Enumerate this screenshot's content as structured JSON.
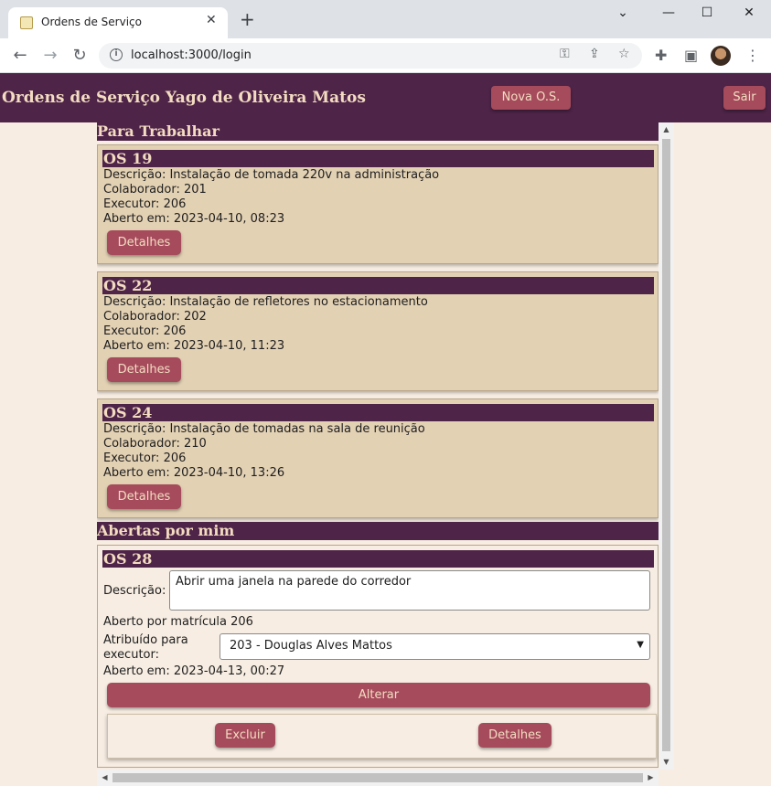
{
  "browser": {
    "tab_title": "Ordens de Serviço",
    "url": "localhost:3000/login"
  },
  "header": {
    "title": "Ordens de Serviço Yago de Oliveira Matos",
    "new_button": "Nova O.S.",
    "logout_button": "Sair"
  },
  "sections": {
    "to_work_title": "Para Trabalhar",
    "opened_by_me_title": "Abertas por mim"
  },
  "work_orders": [
    {
      "title": "OS 19",
      "description": "Descrição: Instalação de tomada 220v na administração",
      "collaborator": "Colaborador: 201",
      "executor": "Executor: 206",
      "opened_at": "Aberto em: 2023-04-10, 08:23",
      "details_button": "Detalhes"
    },
    {
      "title": "OS 22",
      "description": "Descrição: Instalação de refletores no estacionamento",
      "collaborator": "Colaborador: 202",
      "executor": "Executor: 206",
      "opened_at": "Aberto em: 2023-04-10, 11:23",
      "details_button": "Detalhes"
    },
    {
      "title": "OS 24",
      "description": "Descrição: Instalação de tomadas na sala de reunição",
      "collaborator": "Colaborador: 210",
      "executor": "Executor: 206",
      "opened_at": "Aberto em: 2023-04-10, 13:26",
      "details_button": "Detalhes"
    }
  ],
  "my_order": {
    "title": "OS 28",
    "description_label": "Descrição:",
    "description_value": "Abrir uma janela na parede do corredor",
    "opened_by": "Aberto por matrícula 206",
    "assigned_label_line1": "Atribuído para",
    "assigned_label_line2": "executor:",
    "assigned_value": "203 - Douglas Alves Mattos",
    "opened_at": "Aberto em: 2023-04-13, 00:27",
    "update_button": "Alterar",
    "delete_button": "Excluir",
    "details_button": "Detalhes"
  },
  "colors": {
    "primary": "#4e2448",
    "button": "#a54b5c",
    "card": "#e3d1b4",
    "background": "#f7ede2",
    "header_text": "#f3dcc1"
  }
}
